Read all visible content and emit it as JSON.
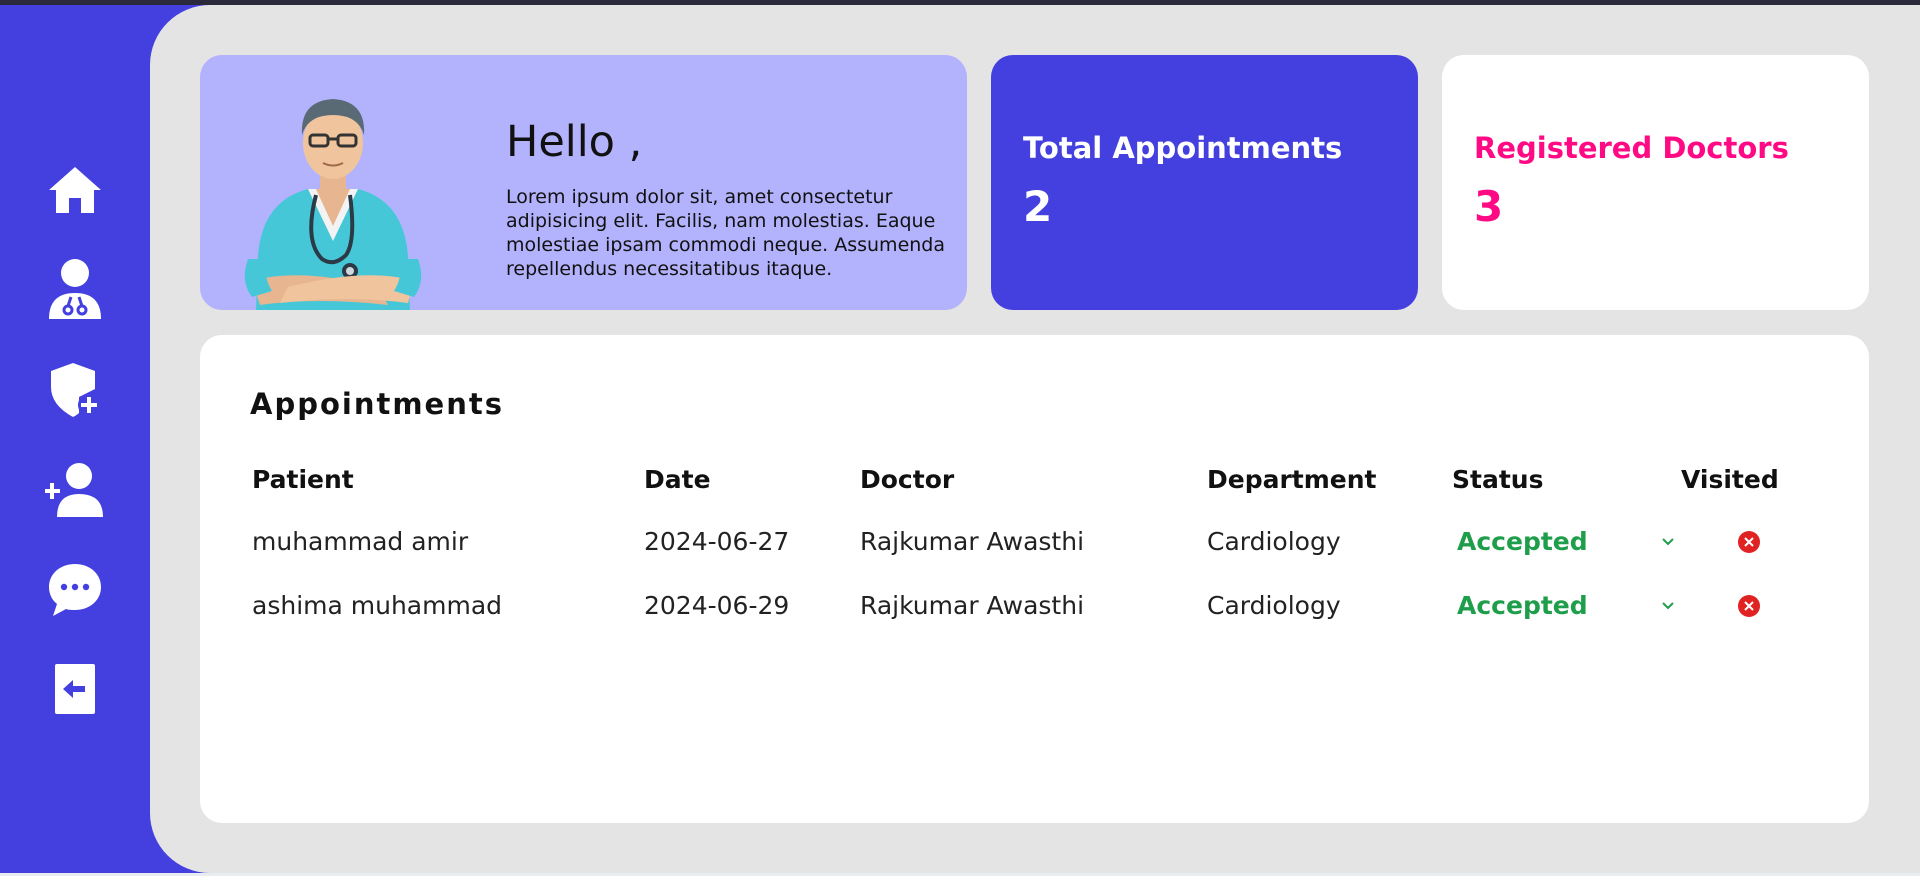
{
  "sidebar": {
    "icons": [
      "home-icon",
      "doctor-icon",
      "shield-plus-icon",
      "add-user-icon",
      "chat-icon",
      "logout-icon"
    ]
  },
  "welcome": {
    "title": "Hello ,",
    "text": "Lorem ipsum dolor sit, amet consectetur adipisicing elit. Facilis, nam molestias. Eaque molestiae ipsam commodi neque. Assumenda repellendus necessitatibus itaque."
  },
  "stats": {
    "total_label": "Total Appointments",
    "total_value": "2",
    "doctors_label": "Registered Doctors",
    "doctors_value": "3"
  },
  "appointments": {
    "title": "Appointments",
    "columns": [
      "Patient",
      "Date",
      "Doctor",
      "Department",
      "Status",
      "Visited"
    ],
    "rows": [
      {
        "patient": "muhammad amir",
        "date": "2024-06-27",
        "doctor": "Rajkumar Awasthi",
        "department": "Cardiology",
        "status": "Accepted",
        "visited": false
      },
      {
        "patient": "ashima muhammad",
        "date": "2024-06-29",
        "doctor": "Rajkumar Awasthi",
        "department": "Cardiology",
        "status": "Accepted",
        "visited": false
      }
    ]
  },
  "colors": {
    "brand": "#4440df",
    "accent_pink": "#ff0a84",
    "status_accepted": "#1e9e4a",
    "visited_no": "#e02222",
    "welcome_bg": "#b3b2fc"
  }
}
